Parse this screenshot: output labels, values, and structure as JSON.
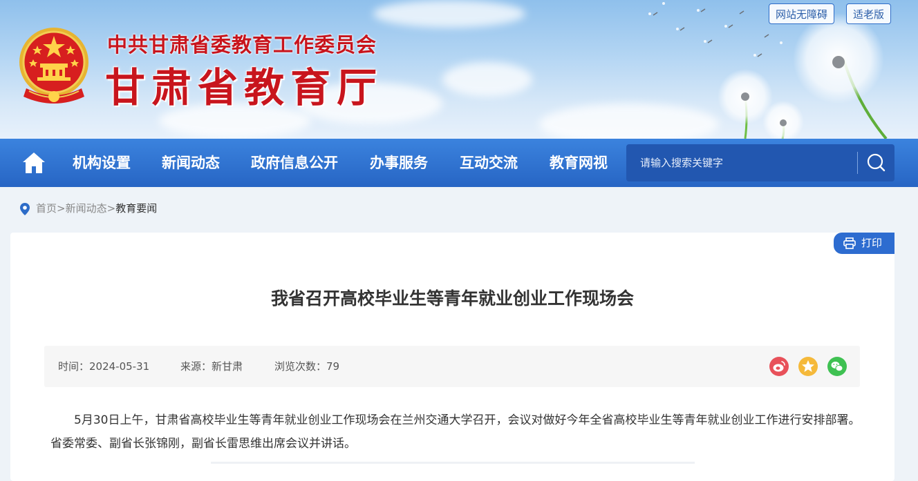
{
  "header": {
    "org_name": "中共甘肃省委教育工作委员会",
    "dept_name": "甘肃省教育厅",
    "accessibility_label": "网站无障碍",
    "elderly_label": "适老版"
  },
  "nav": {
    "home_icon": "home-icon",
    "items": [
      "机构设置",
      "新闻动态",
      "政府信息公开",
      "办事服务",
      "互动交流",
      "教育网视"
    ],
    "search_placeholder": "请输入搜索关键字",
    "search_icon": "search-icon"
  },
  "breadcrumb": {
    "items": [
      "首页",
      "新闻动态"
    ],
    "separator": ">",
    "current": "教育要闻"
  },
  "article": {
    "print_label": "打印",
    "title": "我省召开高校毕业生等青年就业创业工作现场会",
    "meta": {
      "time": "时间：2024-05-31",
      "source": "来源：新甘肃",
      "views": "浏览次数：79"
    },
    "share_icons": [
      "weibo-icon",
      "favorite-star-icon",
      "wechat-icon"
    ],
    "body": "5月30日上午，甘肃省高校毕业生等青年就业创业工作现场会在兰州交通大学召开，会议对做好今年全省高校毕业生等青年就业创业工作进行安排部署。省委常委、副省长张锦刚，副省长雷思维出席会议并讲话。"
  },
  "colors": {
    "brand_red": "#c8151d",
    "nav_blue": "#2d6cc8",
    "search_blue": "#2257b0",
    "weibo": "#e8515a",
    "favorite": "#f5b93a",
    "wechat": "#3fc152"
  }
}
